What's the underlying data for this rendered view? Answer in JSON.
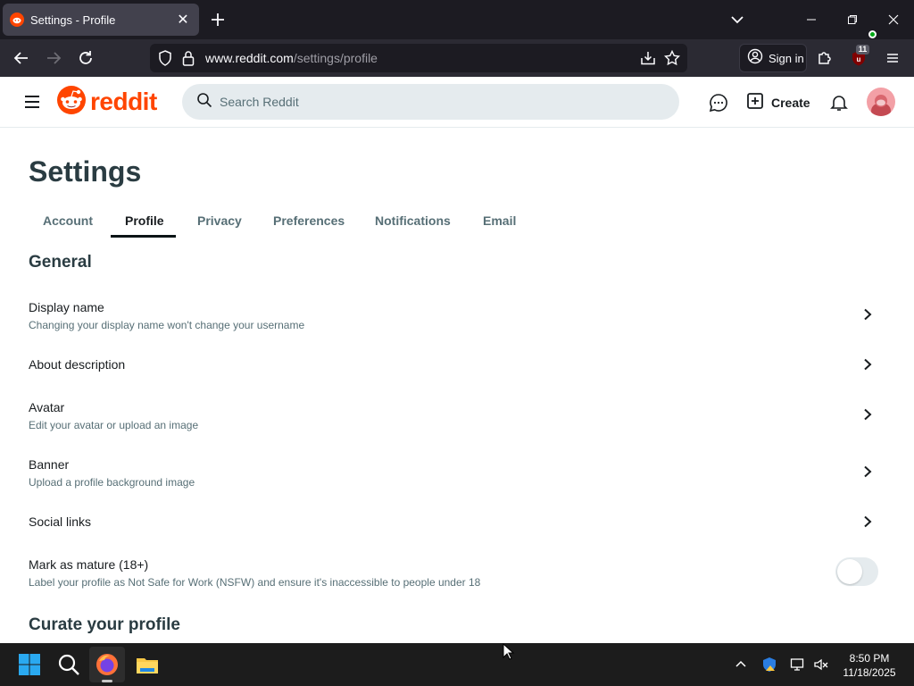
{
  "browser": {
    "tab_title": "Settings - Profile",
    "url_domain": "www.reddit.com",
    "url_path": "/settings/profile",
    "sign_in_label": "Sign in",
    "extension_badge": "11"
  },
  "reddit_header": {
    "logo_text": "reddit",
    "search_placeholder": "Search Reddit",
    "create_label": "Create"
  },
  "page": {
    "title": "Settings",
    "tabs": [
      {
        "label": "Account",
        "active": false
      },
      {
        "label": "Profile",
        "active": true
      },
      {
        "label": "Privacy",
        "active": false
      },
      {
        "label": "Preferences",
        "active": false
      },
      {
        "label": "Notifications",
        "active": false
      },
      {
        "label": "Email",
        "active": false
      }
    ],
    "general_title": "General",
    "rows": [
      {
        "label": "Display name",
        "desc": "Changing your display name won't change your username"
      },
      {
        "label": "About description",
        "desc": ""
      },
      {
        "label": "Avatar",
        "desc": "Edit your avatar or upload an image"
      },
      {
        "label": "Banner",
        "desc": "Upload a profile background image"
      },
      {
        "label": "Social links",
        "desc": ""
      },
      {
        "label": "Mark as mature (18+)",
        "desc": "Label your profile as Not Safe for Work (NSFW) and ensure it's inaccessible to people under 18"
      }
    ],
    "mature_toggle_on": false,
    "curate_title": "Curate your profile"
  },
  "taskbar": {
    "time": "8:50 PM",
    "date": "11/18/2025"
  },
  "colors": {
    "reddit_orange": "#ff4500",
    "browser_dark": "#1c1b22",
    "heading": "#2a3c42",
    "muted": "#576f76"
  }
}
